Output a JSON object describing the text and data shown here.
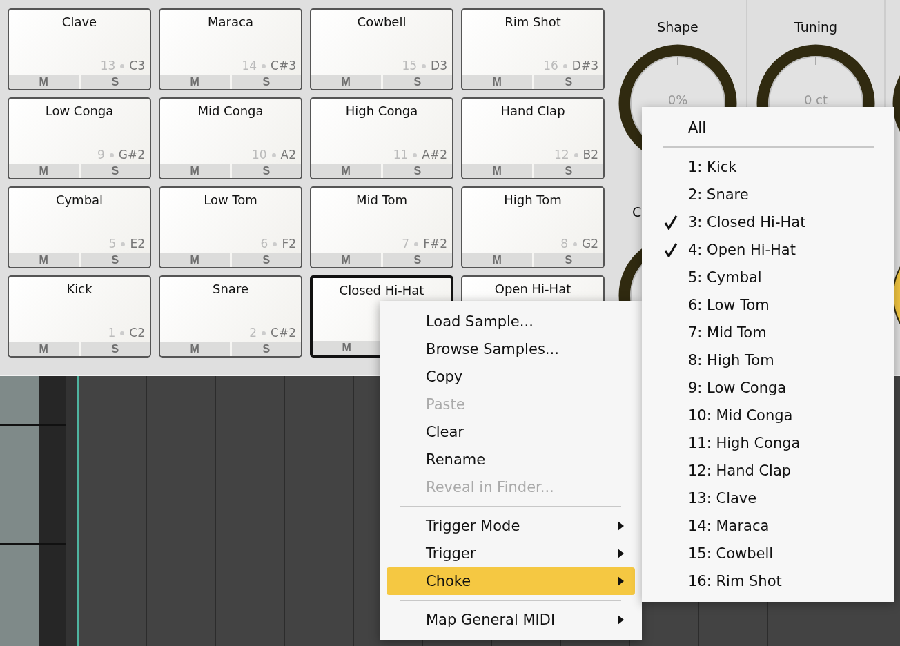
{
  "pads": [
    {
      "name": "Clave",
      "number": "13",
      "note": "C3",
      "mute": "M",
      "solo": "S",
      "selected": false
    },
    {
      "name": "Maraca",
      "number": "14",
      "note": "C#3",
      "mute": "M",
      "solo": "S",
      "selected": false
    },
    {
      "name": "Cowbell",
      "number": "15",
      "note": "D3",
      "mute": "M",
      "solo": "S",
      "selected": false
    },
    {
      "name": "Rim Shot",
      "number": "16",
      "note": "D#3",
      "mute": "M",
      "solo": "S",
      "selected": false
    },
    {
      "name": "Low Conga",
      "number": "9",
      "note": "G#2",
      "mute": "M",
      "solo": "S",
      "selected": false
    },
    {
      "name": "Mid Conga",
      "number": "10",
      "note": "A2",
      "mute": "M",
      "solo": "S",
      "selected": false
    },
    {
      "name": "High Conga",
      "number": "11",
      "note": "A#2",
      "mute": "M",
      "solo": "S",
      "selected": false
    },
    {
      "name": "Hand Clap",
      "number": "12",
      "note": "B2",
      "mute": "M",
      "solo": "S",
      "selected": false
    },
    {
      "name": "Cymbal",
      "number": "5",
      "note": "E2",
      "mute": "M",
      "solo": "S",
      "selected": false
    },
    {
      "name": "Low Tom",
      "number": "6",
      "note": "F2",
      "mute": "M",
      "solo": "S",
      "selected": false
    },
    {
      "name": "Mid Tom",
      "number": "7",
      "note": "F#2",
      "mute": "M",
      "solo": "S",
      "selected": false
    },
    {
      "name": "High Tom",
      "number": "8",
      "note": "G2",
      "mute": "M",
      "solo": "S",
      "selected": false
    },
    {
      "name": "Kick",
      "number": "1",
      "note": "C2",
      "mute": "M",
      "solo": "S",
      "selected": false
    },
    {
      "name": "Snare",
      "number": "2",
      "note": "C#2",
      "mute": "M",
      "solo": "S",
      "selected": false
    },
    {
      "name": "Closed Hi-Hat",
      "mute": "M",
      "selected": true
    },
    {
      "name": "Open Hi-Hat",
      "selected": false
    }
  ],
  "knobs": [
    {
      "kind": "ring",
      "label": "Shape",
      "value": "0%"
    },
    {
      "kind": "ring",
      "label": "Tuning",
      "value": "0 ct"
    },
    {
      "kind": "ring"
    },
    {
      "kind": "ring",
      "label": "C"
    },
    {
      "kind": "blank"
    },
    {
      "kind": "filled"
    }
  ],
  "context_menu": {
    "items": [
      {
        "kind": "item",
        "label": "Load Sample...",
        "disabled": false,
        "selected": false,
        "submenu": false
      },
      {
        "kind": "item",
        "label": "Browse Samples...",
        "disabled": false,
        "selected": false,
        "submenu": false
      },
      {
        "kind": "item",
        "label": "Copy",
        "disabled": false,
        "selected": false,
        "submenu": false
      },
      {
        "kind": "item",
        "label": "Paste",
        "disabled": true,
        "selected": false,
        "submenu": false
      },
      {
        "kind": "item",
        "label": "Clear",
        "disabled": false,
        "selected": false,
        "submenu": false
      },
      {
        "kind": "item",
        "label": "Rename",
        "disabled": false,
        "selected": false,
        "submenu": false
      },
      {
        "kind": "item",
        "label": "Reveal in Finder...",
        "disabled": true,
        "selected": false,
        "submenu": false
      },
      {
        "kind": "separator"
      },
      {
        "kind": "item",
        "label": "Trigger Mode",
        "disabled": false,
        "selected": false,
        "submenu": true
      },
      {
        "kind": "item",
        "label": "Trigger",
        "disabled": false,
        "selected": false,
        "submenu": true
      },
      {
        "kind": "item",
        "label": "Choke",
        "disabled": false,
        "selected": true,
        "submenu": true
      },
      {
        "kind": "separator"
      },
      {
        "kind": "item",
        "label": "Map General MIDI",
        "disabled": false,
        "selected": false,
        "submenu": true
      }
    ]
  },
  "choke_submenu": {
    "items": [
      {
        "kind": "item",
        "label": "All",
        "checked": false
      },
      {
        "kind": "separator"
      },
      {
        "kind": "item",
        "label": "1: Kick",
        "checked": false
      },
      {
        "kind": "item",
        "label": "2: Snare",
        "checked": false
      },
      {
        "kind": "item",
        "label": "3: Closed Hi-Hat",
        "checked": true
      },
      {
        "kind": "item",
        "label": "4: Open Hi-Hat",
        "checked": true
      },
      {
        "kind": "item",
        "label": "5: Cymbal",
        "checked": false
      },
      {
        "kind": "item",
        "label": "6: Low Tom",
        "checked": false
      },
      {
        "kind": "item",
        "label": "7: Mid Tom",
        "checked": false
      },
      {
        "kind": "item",
        "label": "8: High Tom",
        "checked": false
      },
      {
        "kind": "item",
        "label": "9: Low Conga",
        "checked": false
      },
      {
        "kind": "item",
        "label": "10: Mid Conga",
        "checked": false
      },
      {
        "kind": "item",
        "label": "11: High Conga",
        "checked": false
      },
      {
        "kind": "item",
        "label": "12: Hand Clap",
        "checked": false
      },
      {
        "kind": "item",
        "label": "13: Clave",
        "checked": false
      },
      {
        "kind": "item",
        "label": "14: Maraca",
        "checked": false
      },
      {
        "kind": "item",
        "label": "15: Cowbell",
        "checked": false
      },
      {
        "kind": "item",
        "label": "16: Rim Shot",
        "checked": false
      }
    ]
  }
}
